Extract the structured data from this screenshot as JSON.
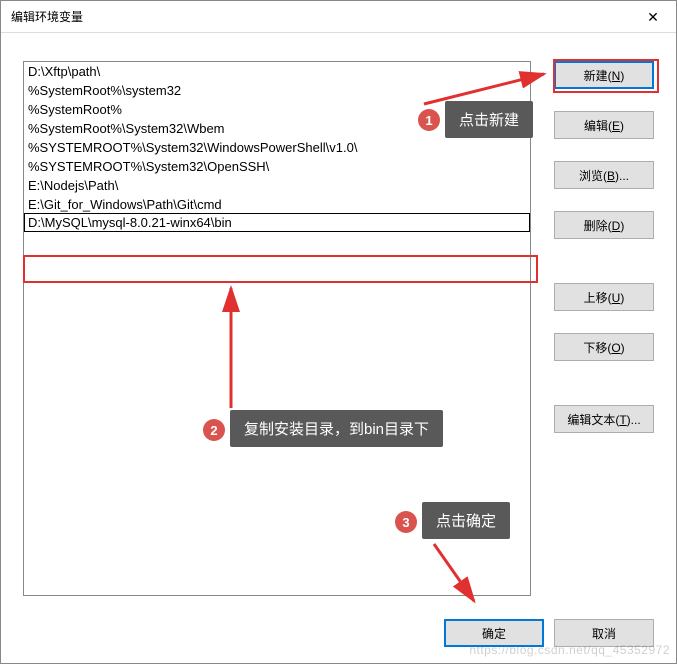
{
  "titlebar": {
    "text": "编辑环境变量"
  },
  "list": {
    "items": [
      "D:\\Xftp\\path\\",
      "%SystemRoot%\\system32",
      "%SystemRoot%",
      "%SystemRoot%\\System32\\Wbem",
      "%SYSTEMROOT%\\System32\\WindowsPowerShell\\v1.0\\",
      "%SYSTEMROOT%\\System32\\OpenSSH\\",
      "E:\\Nodejs\\Path\\",
      "E:\\Git_for_Windows\\Path\\Git\\cmd",
      "D:\\MySQL\\mysql-8.0.21-winx64\\bin"
    ]
  },
  "buttons": {
    "new": "新建(N)",
    "edit": "编辑(E)",
    "browse": "浏览(B)...",
    "delete": "删除(D)",
    "moveup": "上移(U)",
    "movedown": "下移(O)",
    "edittext": "编辑文本(T)...",
    "ok": "确定",
    "cancel": "取消"
  },
  "annotations": {
    "tip1": "点击新建",
    "tip2": "复制安装目录，到bin目录下",
    "tip3": "点击确定",
    "badge1": "1",
    "badge2": "2",
    "badge3": "3"
  },
  "watermark": "https://blog.csdn.net/qq_45352972"
}
